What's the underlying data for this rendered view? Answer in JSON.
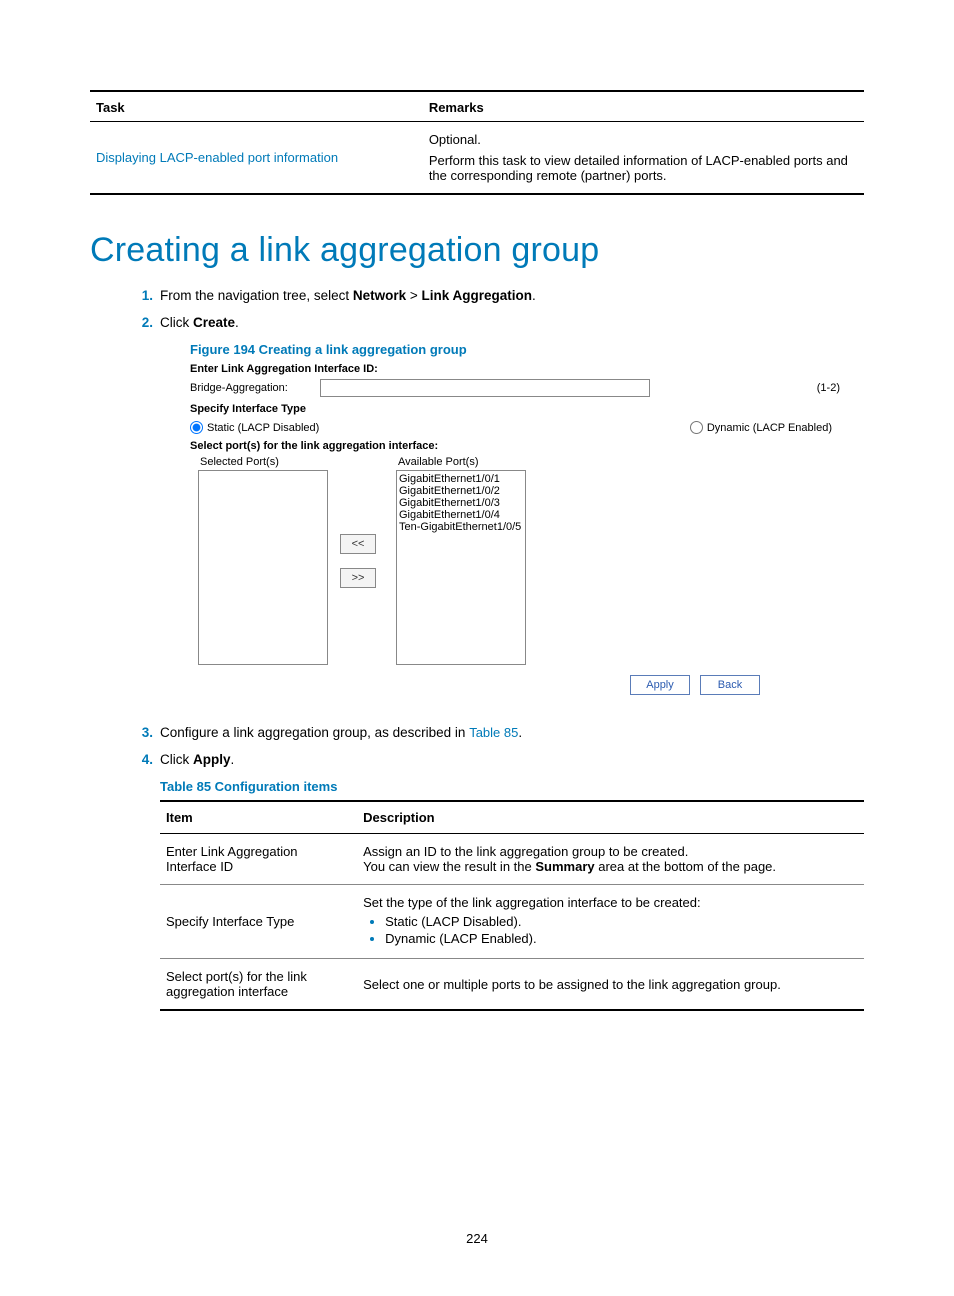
{
  "top_table": {
    "headers": [
      "Task",
      "Remarks"
    ],
    "row": {
      "task_link": "Displaying LACP-enabled port information",
      "remarks_line1": "Optional.",
      "remarks_line2": "Perform this task to view detailed information of LACP-enabled ports and the corresponding remote (partner) ports."
    }
  },
  "heading": "Creating a link aggregation group",
  "steps": {
    "s1_pre": "From the navigation tree, select ",
    "s1_b1": "Network",
    "s1_mid": " > ",
    "s1_b2": "Link Aggregation",
    "s1_post": ".",
    "s2_pre": "Click ",
    "s2_b": "Create",
    "s2_post": ".",
    "s3_pre": "Configure a link aggregation group, as described in ",
    "s3_link": "Table 85",
    "s3_post": ".",
    "s4_pre": "Click ",
    "s4_b": "Apply",
    "s4_post": "."
  },
  "figure_caption": "Figure 194 Creating a link aggregation group",
  "form": {
    "enter_id_label": "Enter Link Aggregation Interface ID:",
    "bridge_label": "Bridge-Aggregation:",
    "bridge_hint": "(1-2)",
    "specify_label": "Specify Interface Type",
    "radio_static": "Static (LACP Disabled)",
    "radio_dynamic": "Dynamic (LACP Enabled)",
    "select_ports_label": "Select port(s) for the link aggregation interface:",
    "selected_col": "Selected Port(s)",
    "available_col": "Available Port(s)",
    "available_ports": [
      "GigabitEthernet1/0/1",
      "GigabitEthernet1/0/2",
      "GigabitEthernet1/0/3",
      "GigabitEthernet1/0/4",
      "Ten-GigabitEthernet1/0/5"
    ],
    "move_left": "<<",
    "move_right": ">>",
    "apply": "Apply",
    "back": "Back"
  },
  "table_caption": "Table 85 Configuration items",
  "config_table": {
    "headers": [
      "Item",
      "Description"
    ],
    "rows": [
      {
        "item": "Enter Link Aggregation Interface ID",
        "desc_line1": "Assign an ID to the link aggregation group to be created.",
        "desc_line2_pre": "You can view the result in the ",
        "desc_line2_bold": "Summary",
        "desc_line2_post": " area at the bottom of the page."
      },
      {
        "item": "Specify Interface Type",
        "desc_line1": "Set the type of the link aggregation interface to be created:",
        "bullets": [
          "Static (LACP Disabled).",
          "Dynamic (LACP Enabled)."
        ]
      },
      {
        "item": "Select port(s) for the link aggregation interface",
        "desc_line1": "Select one or multiple ports to be assigned to the link aggregation group."
      }
    ]
  },
  "page_number": "224"
}
